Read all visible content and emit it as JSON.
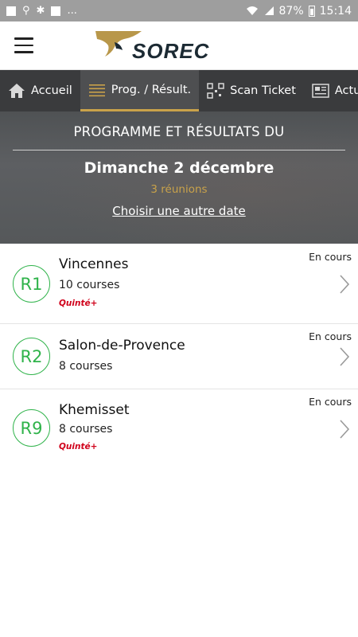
{
  "status_bar": {
    "left_dots": "...",
    "battery": "87%",
    "time": "15:14"
  },
  "header": {
    "logo_text": "SOREC"
  },
  "tabs": [
    {
      "label": "Accueil",
      "icon": "home-icon"
    },
    {
      "label": "Prog. / Résult.",
      "icon": "list-icon",
      "active": true
    },
    {
      "label": "Scan Ticket",
      "icon": "qr-icon"
    },
    {
      "label": "Actu",
      "icon": "news-icon"
    }
  ],
  "hero": {
    "title": "PROGRAMME ET RÉSULTATS DU",
    "date": "Dimanche 2 décembre",
    "count": "3 réunions",
    "link": "Choisir une autre date"
  },
  "meetings": [
    {
      "code": "R1",
      "venue": "Vincennes",
      "courses": "10 courses",
      "tag": "Quinté+",
      "status": "En cours"
    },
    {
      "code": "R2",
      "venue": "Salon-de-Provence",
      "courses": "8 courses",
      "tag": "",
      "status": "En cours"
    },
    {
      "code": "R9",
      "venue": "Khemisset",
      "courses": "8 courses",
      "tag": "Quinté+",
      "status": "En cours"
    }
  ],
  "colors": {
    "accent_gold": "#c9a24a",
    "badge_green": "#2fb34a",
    "quinte_red": "#d0021b",
    "tab_bar": "#3a3b3d"
  }
}
